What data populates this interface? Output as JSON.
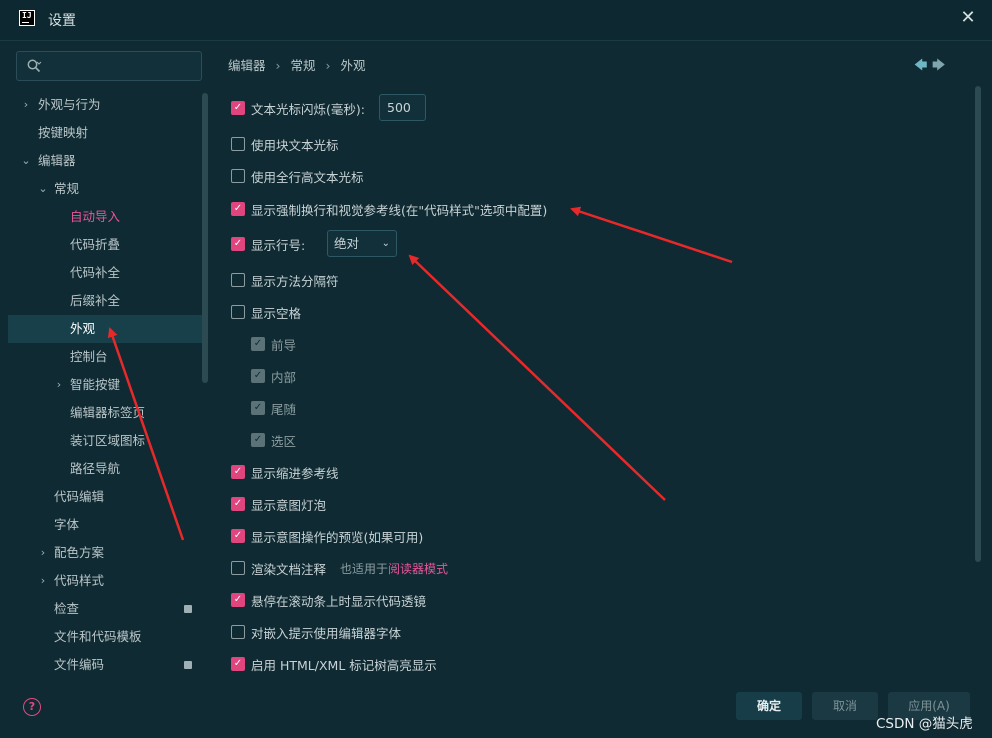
{
  "window": {
    "title": "设置"
  },
  "search": {
    "placeholder": "",
    "value": ""
  },
  "sidebar": {
    "items": [
      {
        "label": "外观与行为",
        "indent": 0,
        "chevron": "›"
      },
      {
        "label": "按键映射",
        "indent": 0,
        "chevron": ""
      },
      {
        "label": "编辑器",
        "indent": 0,
        "chevron": "⌄"
      },
      {
        "label": "常规",
        "indent": 1,
        "chevron": "⌄"
      },
      {
        "label": "自动导入",
        "indent": 2,
        "chevron": ""
      },
      {
        "label": "代码折叠",
        "indent": 2,
        "chevron": ""
      },
      {
        "label": "代码补全",
        "indent": 2,
        "chevron": ""
      },
      {
        "label": "后缀补全",
        "indent": 2,
        "chevron": ""
      },
      {
        "label": "外观",
        "indent": 2,
        "chevron": ""
      },
      {
        "label": "控制台",
        "indent": 2,
        "chevron": ""
      },
      {
        "label": "智能按键",
        "indent": 2,
        "chevron": "›"
      },
      {
        "label": "编辑器标签页",
        "indent": 2,
        "chevron": ""
      },
      {
        "label": "装订区域图标",
        "indent": 2,
        "chevron": ""
      },
      {
        "label": "路径导航",
        "indent": 2,
        "chevron": ""
      },
      {
        "label": "代码编辑",
        "indent": 1,
        "chevron": ""
      },
      {
        "label": "字体",
        "indent": 1,
        "chevron": ""
      },
      {
        "label": "配色方案",
        "indent": 1,
        "chevron": "›"
      },
      {
        "label": "代码样式",
        "indent": 1,
        "chevron": "›"
      },
      {
        "label": "检查",
        "indent": 1,
        "chevron": ""
      },
      {
        "label": "文件和代码模板",
        "indent": 1,
        "chevron": ""
      },
      {
        "label": "文件编码",
        "indent": 1,
        "chevron": ""
      }
    ],
    "selected": "外观",
    "highlighted": "自动导入"
  },
  "breadcrumb": [
    "编辑器",
    "外观"
  ],
  "breadcrumb_full": {
    "a": "编辑器",
    "b": "常规",
    "c": "外观",
    "sep": "›"
  },
  "options": {
    "caret_blink": {
      "label": "文本光标闪烁(毫秒):",
      "checked": true,
      "value": "500"
    },
    "block_caret": {
      "label": "使用块文本光标",
      "checked": false
    },
    "full_line_caret": {
      "label": "使用全行高文本光标",
      "checked": false
    },
    "hard_wraps": {
      "label": "显示强制换行和视觉参考线(在\"代码样式\"选项中配置)",
      "checked": true
    },
    "line_numbers": {
      "label": "显示行号:",
      "checked": true,
      "select_value": "绝对"
    },
    "method_separators": {
      "label": "显示方法分隔符",
      "checked": false
    },
    "whitespaces": {
      "label": "显示空格",
      "checked": false
    },
    "ws_leading": {
      "label": "前导",
      "checked": true
    },
    "ws_inner": {
      "label": "内部",
      "checked": true
    },
    "ws_trailing": {
      "label": "尾随",
      "checked": true
    },
    "ws_selection": {
      "label": "选区",
      "checked": true
    },
    "indent_guides": {
      "label": "显示缩进参考线",
      "checked": true
    },
    "intention_bulb": {
      "label": "显示意图灯泡",
      "checked": true
    },
    "intention_preview": {
      "label": "显示意图操作的预览(如果可用)",
      "checked": true
    },
    "render_doc": {
      "label": "渲染文档注释",
      "checked": false,
      "hint": "也适用于",
      "hint_link": "阅读器模式"
    },
    "code_lens_scroll": {
      "label": "悬停在滚动条上时显示代码透镜",
      "checked": true
    },
    "inlay_font": {
      "label": "对嵌入提示使用编辑器字体",
      "checked": false
    },
    "html_tree": {
      "label": "启用 HTML/XML 标记树高亮显示",
      "checked": true
    }
  },
  "buttons": {
    "ok": "确定",
    "cancel": "取消",
    "apply": "应用(A)"
  },
  "watermark": "CSDN @猫头虎",
  "colors": {
    "accent": "#e0457e",
    "arrow": "#e8292a",
    "background": "#0f2a32"
  }
}
